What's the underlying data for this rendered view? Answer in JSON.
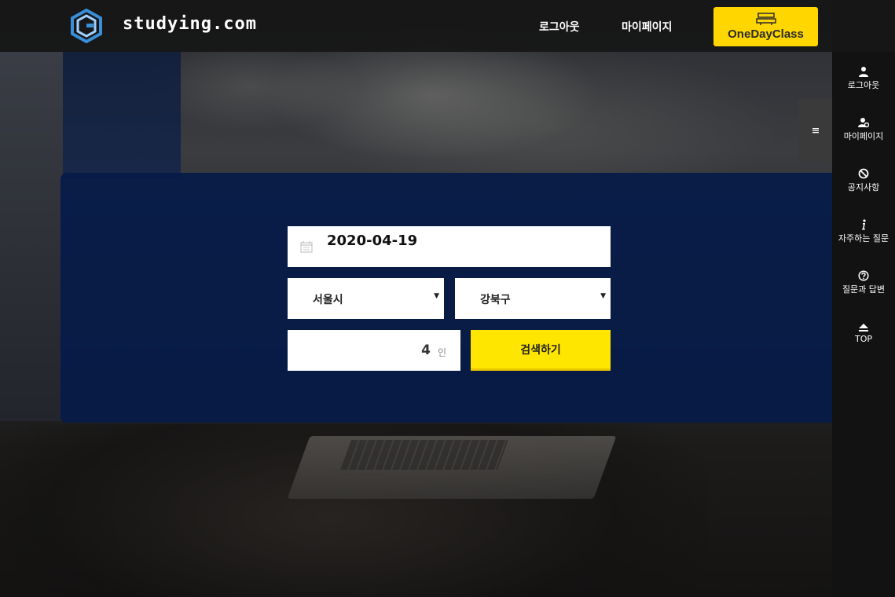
{
  "header": {
    "logo_text": "studying.com",
    "nav": {
      "logout": "로그아웃",
      "mypage": "마이페이지"
    },
    "cta": {
      "label": "OneDayClass",
      "icon": "class-board-icon",
      "color": "#ffd600"
    }
  },
  "sidebar": {
    "items": [
      {
        "label": "로그아웃",
        "icon": "user-icon"
      },
      {
        "label": "마이페이지",
        "icon": "user-settings-icon"
      },
      {
        "label": "공지사항",
        "icon": "notice-icon"
      },
      {
        "label": "자주하는 질문",
        "icon": "info-icon"
      },
      {
        "label": "질문과 답변",
        "icon": "question-icon"
      },
      {
        "label": "TOP",
        "icon": "arrow-up-icon"
      }
    ],
    "toggle_icon": "menu-icon"
  },
  "search": {
    "date": "2020-04-19",
    "city": "서울시",
    "district": "강북구",
    "people_count": "4",
    "people_unit": "인",
    "submit_label": "검색하기",
    "panel_color": "#051b48",
    "button_color": "#ffe600"
  }
}
